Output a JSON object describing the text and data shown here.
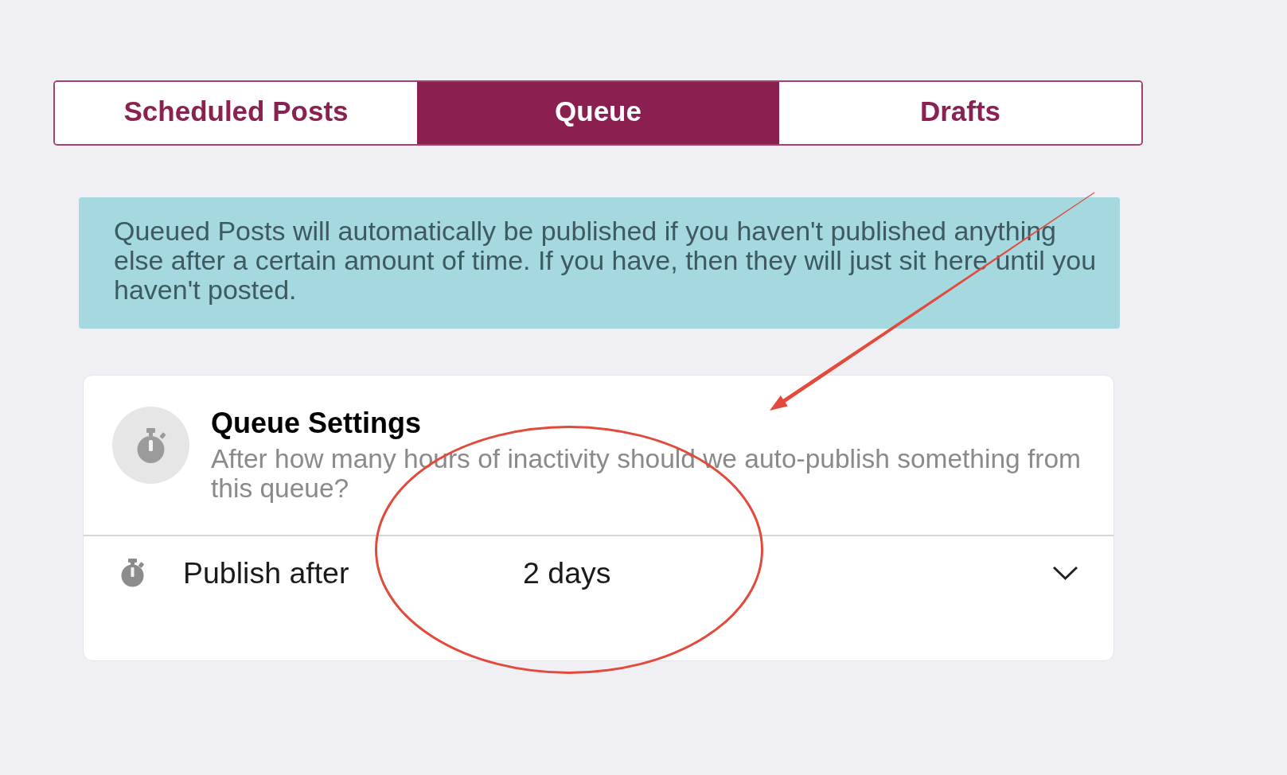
{
  "tabs": [
    {
      "label": "Scheduled Posts",
      "selected": false
    },
    {
      "label": "Queue",
      "selected": true
    },
    {
      "label": "Drafts",
      "selected": false
    }
  ],
  "notice": {
    "text": "Queued Posts will automatically be published if you haven't published anything else after a certain amount of time. If you have, then they will just sit here until you haven't posted."
  },
  "queue_settings": {
    "title": "Queue Settings",
    "description": "After how many hours of inactivity should we auto-publish something from this queue?",
    "publish_after": {
      "label": "Publish after",
      "value": "2 days"
    }
  },
  "annotations": [
    {
      "kind": "ellipse"
    },
    {
      "kind": "arrow"
    }
  ]
}
